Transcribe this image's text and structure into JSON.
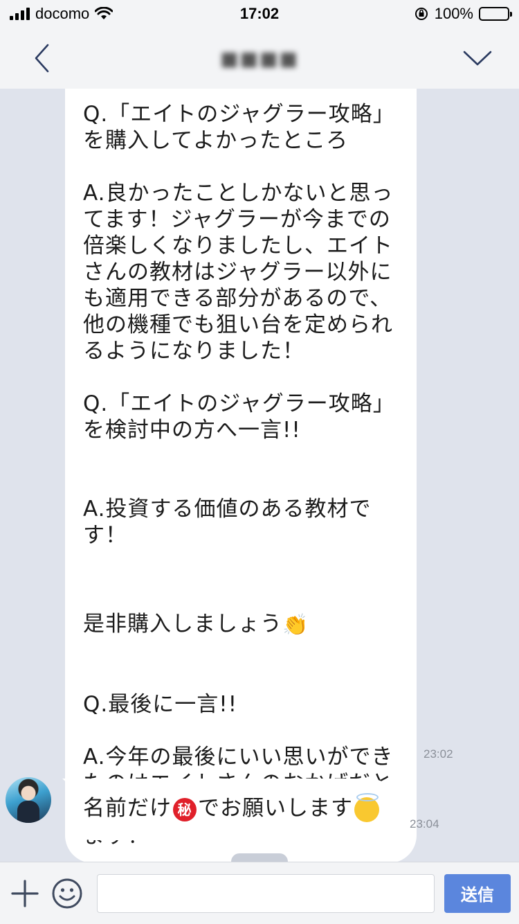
{
  "status_bar": {
    "carrier": "docomo",
    "time": "17:02",
    "battery_percent": "100%",
    "battery_level": 1.0
  },
  "nav": {
    "title": "■■■■",
    "back_icon": "chevron-left-icon",
    "menu_icon": "chevron-down-icon"
  },
  "messages": {
    "main": {
      "q1": "Q.「エイトのジャグラー攻略」\nを購入してよかったところ",
      "a1": "A.良かったことしかないと思っ\nてます！ジャグラーが今までの\n倍楽しくなりましたし、エイト\nさんの教材はジャグラー以外に\nも適用できる部分があるので、\n他の機種でも狙い台を定められ\nるようになりました！",
      "q2": "Q.「エイトのジャグラー攻略」\nを検討中の方へ一言!!",
      "a2": "A.投資する価値のある教材で\nす！",
      "a2_extra": "是非購入しましょう",
      "a2_emoji": "👏",
      "q3": "Q.最後に一言!!",
      "a3": "A.今年の最後にいい思いができ\nたのはエイトさんのおかげだと\n思ってます！ありがとうござい\nます！",
      "time": "23:02"
    },
    "short": {
      "text_before": "名前だけ",
      "secret_mark": "秘",
      "text_after": "でお願いします",
      "emoji": "smiling-face-with-halo",
      "time": "23:04"
    }
  },
  "input_bar": {
    "placeholder": "",
    "send_label": "送信",
    "add_icon": "plus-icon",
    "sticker_icon": "smiley-icon"
  }
}
